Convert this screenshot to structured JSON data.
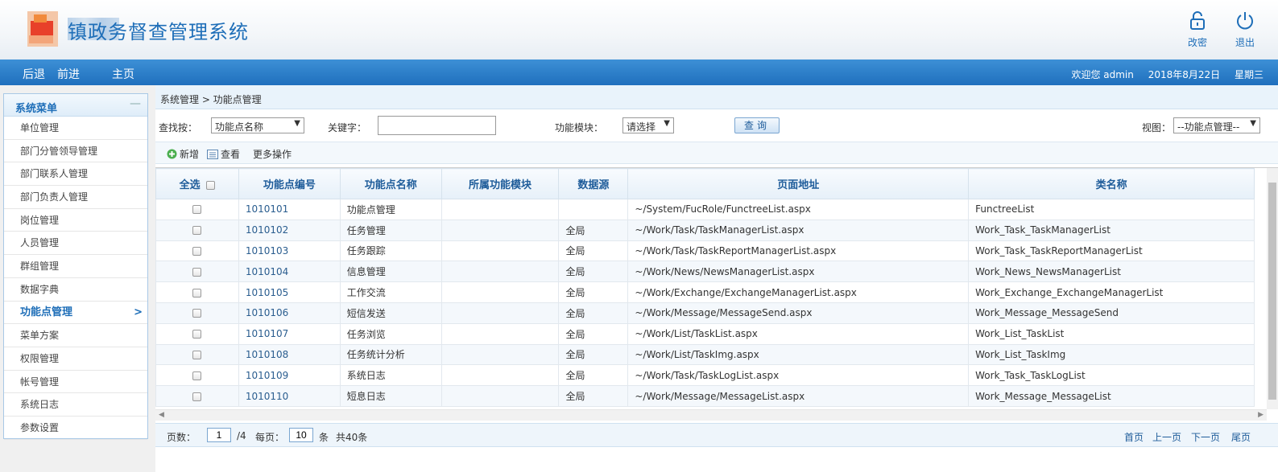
{
  "header": {
    "title": "镇政务督查管理系统",
    "buttons": {
      "change_password": "改密",
      "logout": "退出"
    }
  },
  "nav": {
    "back": "后退",
    "forward": "前进",
    "home": "主页",
    "welcome": "欢迎您 admin",
    "date": "2018年8月22日",
    "weekday": "星期三"
  },
  "sidebar": {
    "title": "系统菜单",
    "collapse": "—",
    "items": [
      "单位管理",
      "部门分管领导管理",
      "部门联系人管理",
      "部门负责人管理",
      "岗位管理",
      "人员管理",
      "群组管理",
      "数据字典",
      "功能点管理",
      "菜单方案",
      "权限管理",
      "帐号管理",
      "系统日志",
      "参数设置"
    ],
    "active_index": 8,
    "active_arrow": ">"
  },
  "breadcrumb": "系统管理 > 功能点管理",
  "search": {
    "find_by_label": "查找按：",
    "find_by_value": "功能点名称",
    "keyword_label": "关键字：",
    "keyword_value": "",
    "module_label": "功能模块：",
    "module_value": "请选择",
    "query_button": "查询",
    "view_label": "视图：",
    "view_value": "--功能点管理--"
  },
  "toolbar": {
    "add": "新增",
    "view": "查看",
    "more": "更多操作"
  },
  "table": {
    "select_all": "全选",
    "columns": [
      "功能点编号",
      "功能点名称",
      "所属功能模块",
      "数据源",
      "页面地址",
      "类名称"
    ],
    "rows": [
      [
        "1010101",
        "功能点管理",
        "",
        "",
        "~/System/FucRole/FunctreeList.aspx",
        "FunctreeList"
      ],
      [
        "1010102",
        "任务管理",
        "",
        "全局",
        "~/Work/Task/TaskManagerList.aspx",
        "Work_Task_TaskManagerList"
      ],
      [
        "1010103",
        "任务跟踪",
        "",
        "全局",
        "~/Work/Task/TaskReportManagerList.aspx",
        "Work_Task_TaskReportManagerList"
      ],
      [
        "1010104",
        "信息管理",
        "",
        "全局",
        "~/Work/News/NewsManagerList.aspx",
        "Work_News_NewsManagerList"
      ],
      [
        "1010105",
        "工作交流",
        "",
        "全局",
        "~/Work/Exchange/ExchangeManagerList.aspx",
        "Work_Exchange_ExchangeManagerList"
      ],
      [
        "1010106",
        "短信发送",
        "",
        "全局",
        "~/Work/Message/MessageSend.aspx",
        "Work_Message_MessageSend"
      ],
      [
        "1010107",
        "任务浏览",
        "",
        "全局",
        "~/Work/List/TaskList.aspx",
        "Work_List_TaskList"
      ],
      [
        "1010108",
        "任务统计分析",
        "",
        "全局",
        "~/Work/List/TaskImg.aspx",
        "Work_List_TaskImg"
      ],
      [
        "1010109",
        "系统日志",
        "",
        "全局",
        "~/Work/Task/TaskLogList.aspx",
        "Work_Task_TaskLogList"
      ],
      [
        "1010110",
        "短息日志",
        "",
        "全局",
        "~/Work/Message/MessageList.aspx",
        "Work_Message_MessageList"
      ]
    ]
  },
  "pager": {
    "page_label": "页数：",
    "current_page": "1",
    "total_pages": "/4",
    "per_page_label": "每页：",
    "per_page": "10",
    "per_page_unit": "条",
    "total": "共40条",
    "first": "首页",
    "prev": "上一页",
    "next": "下一页",
    "last": "尾页"
  },
  "colors": {
    "brand": "#1e6eb8",
    "nav_bar": "#2a7fcc"
  }
}
